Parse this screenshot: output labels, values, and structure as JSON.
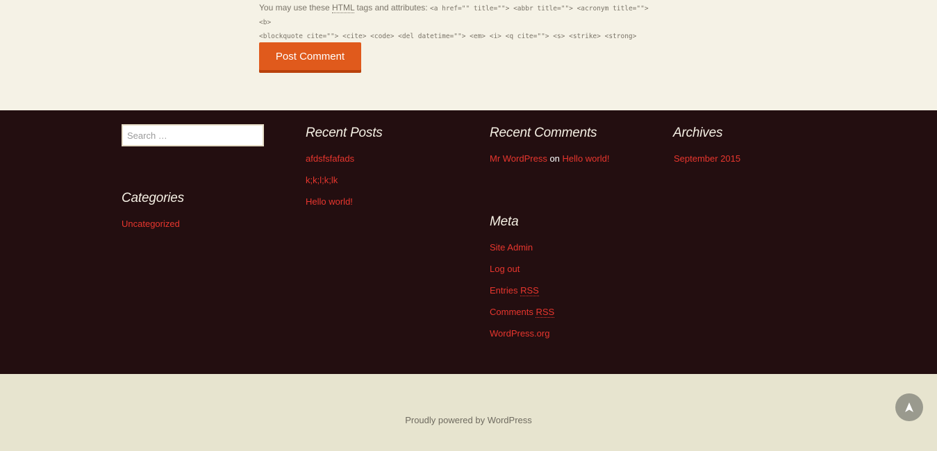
{
  "comment_form": {
    "allowed_tags_intro": "You may use these",
    "allowed_tags_abbr": "HTML",
    "allowed_tags_intro_end": "tags and attributes:",
    "allowed_tags_line1": "<a href=\"\" title=\"\"> <abbr title=\"\"> <acronym title=\"\"> <b>",
    "allowed_tags_line2": "<blockquote cite=\"\"> <cite> <code> <del datetime=\"\"> <em> <i> <q cite=\"\"> <s> <strike> <strong>",
    "submit_label": "Post Comment"
  },
  "footer": {
    "search": {
      "placeholder": "Search …"
    },
    "categories": {
      "title": "Categories",
      "items": [
        "Uncategorized"
      ]
    },
    "recent_posts": {
      "title": "Recent Posts",
      "items": [
        "afdsfsfafads",
        "k;k;l;k;lk",
        "Hello world!"
      ]
    },
    "recent_comments": {
      "title": "Recent Comments",
      "items": [
        {
          "author": "Mr WordPress",
          "connector": "on",
          "post": "Hello world!"
        }
      ]
    },
    "archives": {
      "title": "Archives",
      "items": [
        "September 2015"
      ]
    },
    "meta": {
      "title": "Meta",
      "site_admin": "Site Admin",
      "log_out": "Log out",
      "entries_label": "Entries",
      "comments_label": "Comments",
      "rss": "RSS",
      "wordpress_org": "WordPress.org"
    }
  },
  "site_info": {
    "credit": "Proudly powered by WordPress"
  },
  "colors": {
    "accent": "#e05a1c",
    "link": "#e8362e",
    "footer_bg": "#230e10",
    "page_bg": "#f5f2e6",
    "bottom_bg": "#e7e4cf"
  },
  "icons": {
    "back_to_top": "arrow-up-icon"
  }
}
